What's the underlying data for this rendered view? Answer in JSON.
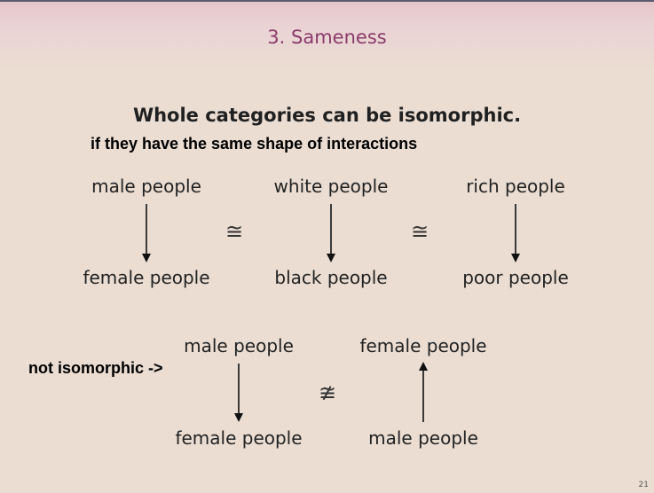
{
  "slide": {
    "title": "3. Sameness",
    "heading": "Whole categories can be isomorphic.",
    "annotation_shape": "if they have the same shape of interactions",
    "annotation_not_iso": "not isomorphic ->",
    "page_number": "21",
    "accent_color": "#8a3a6a"
  },
  "diagram_top": {
    "col1": {
      "top": "male people",
      "bottom": "female people",
      "arrow": "down"
    },
    "rel1": "≅",
    "col2": {
      "top": "white people",
      "bottom": "black people",
      "arrow": "down"
    },
    "rel2": "≅",
    "col3": {
      "top": "rich people",
      "bottom": "poor people",
      "arrow": "down"
    }
  },
  "diagram_bottom": {
    "col1": {
      "top": "male people",
      "bottom": "female people",
      "arrow": "down"
    },
    "rel": "≇",
    "col2": {
      "top": "female people",
      "bottom": "male people",
      "arrow": "up"
    }
  }
}
